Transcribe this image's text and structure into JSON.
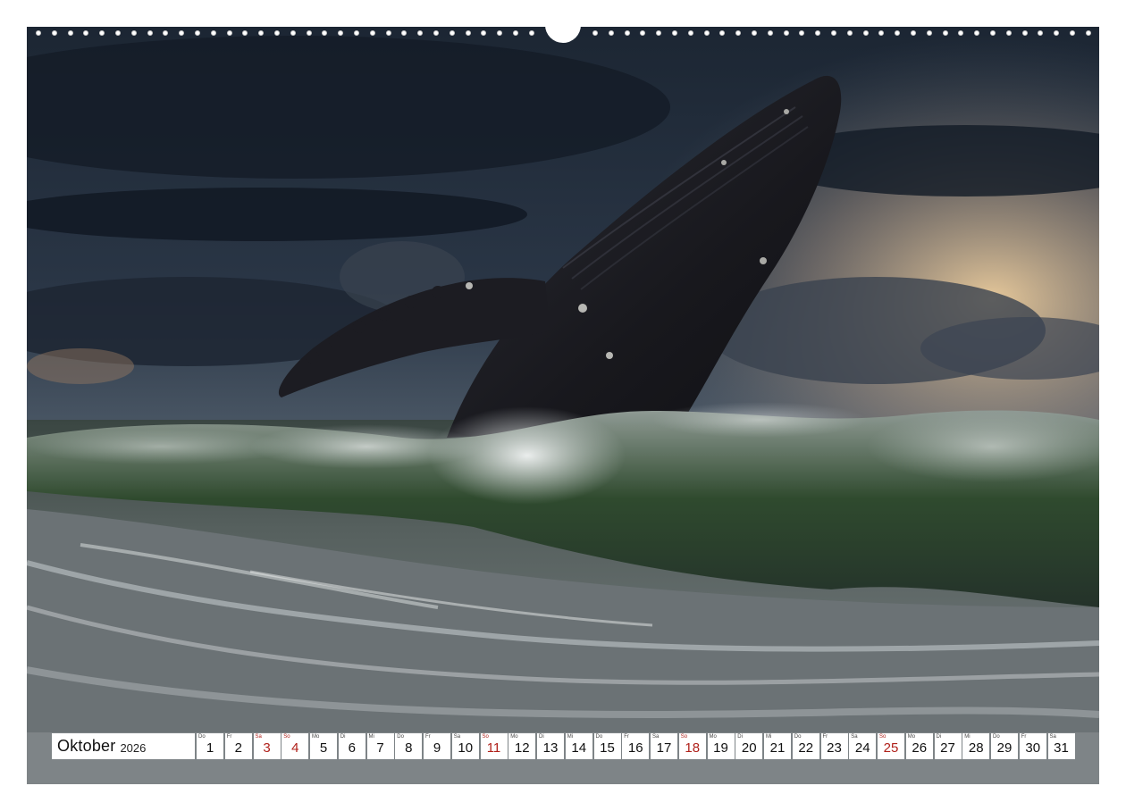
{
  "calendar": {
    "month": "Oktober",
    "year": "2026",
    "days": [
      {
        "wd": "Do",
        "num": "1",
        "sunday": false
      },
      {
        "wd": "Fr",
        "num": "2",
        "sunday": false
      },
      {
        "wd": "Sa",
        "num": "3",
        "sunday": true
      },
      {
        "wd": "So",
        "num": "4",
        "sunday": true
      },
      {
        "wd": "Mo",
        "num": "5",
        "sunday": false
      },
      {
        "wd": "Di",
        "num": "6",
        "sunday": false
      },
      {
        "wd": "Mi",
        "num": "7",
        "sunday": false
      },
      {
        "wd": "Do",
        "num": "8",
        "sunday": false
      },
      {
        "wd": "Fr",
        "num": "9",
        "sunday": false
      },
      {
        "wd": "Sa",
        "num": "10",
        "sunday": false
      },
      {
        "wd": "So",
        "num": "11",
        "sunday": true
      },
      {
        "wd": "Mo",
        "num": "12",
        "sunday": false
      },
      {
        "wd": "Di",
        "num": "13",
        "sunday": false
      },
      {
        "wd": "Mi",
        "num": "14",
        "sunday": false
      },
      {
        "wd": "Do",
        "num": "15",
        "sunday": false
      },
      {
        "wd": "Fr",
        "num": "16",
        "sunday": false
      },
      {
        "wd": "Sa",
        "num": "17",
        "sunday": false
      },
      {
        "wd": "So",
        "num": "18",
        "sunday": true
      },
      {
        "wd": "Mo",
        "num": "19",
        "sunday": false
      },
      {
        "wd": "Di",
        "num": "20",
        "sunday": false
      },
      {
        "wd": "Mi",
        "num": "21",
        "sunday": false
      },
      {
        "wd": "Do",
        "num": "22",
        "sunday": false
      },
      {
        "wd": "Fr",
        "num": "23",
        "sunday": false
      },
      {
        "wd": "Sa",
        "num": "24",
        "sunday": false
      },
      {
        "wd": "So",
        "num": "25",
        "sunday": true
      },
      {
        "wd": "Mo",
        "num": "26",
        "sunday": false
      },
      {
        "wd": "Di",
        "num": "27",
        "sunday": false
      },
      {
        "wd": "Mi",
        "num": "28",
        "sunday": false
      },
      {
        "wd": "Do",
        "num": "29",
        "sunday": false
      },
      {
        "wd": "Fr",
        "num": "30",
        "sunday": false
      },
      {
        "wd": "Sa",
        "num": "31",
        "sunday": false
      }
    ]
  },
  "colors": {
    "holiday_red": "#b0201a",
    "sky_dark": "#1f2a38",
    "sky_glow": "#e9c89a",
    "sea": "#5a6468",
    "whale": "#1a1a1f"
  }
}
